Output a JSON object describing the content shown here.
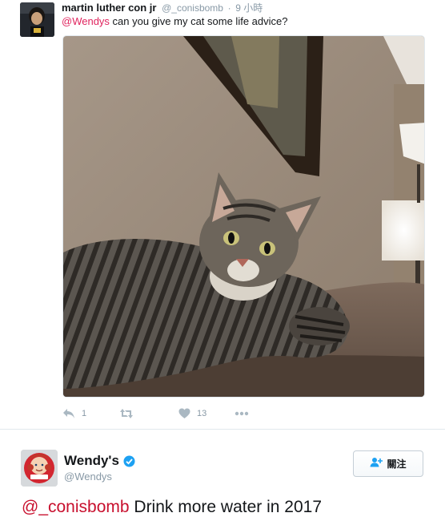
{
  "tweet1": {
    "fullname": "martin luther con jr",
    "handle": "@_conisbomb",
    "separator": "·",
    "time": "9 小時",
    "mention": "@Wendys",
    "body": " can you give my cat some life advice?",
    "actions": {
      "reply_icon": "reply-icon",
      "reply_count": "1",
      "retweet_icon": "retweet-icon",
      "like_icon": "heart-icon",
      "like_count": "13",
      "more_icon": "more-icon"
    }
  },
  "tweet2": {
    "fullname": "Wendy's",
    "verified_icon": "verified-badge-icon",
    "handle": "@Wendys",
    "follow_label": "關注",
    "follow_icon": "follow-person-icon",
    "mention": "@_conisbomb",
    "body": " Drink more water in 2017"
  },
  "colors": {
    "mention_pink": "#e0245e",
    "mention_red": "#c8102e",
    "muted": "#8899a6",
    "icon_grey": "#aab8c2",
    "verified_blue": "#1da1f2",
    "wendys_red": "#d22630"
  }
}
